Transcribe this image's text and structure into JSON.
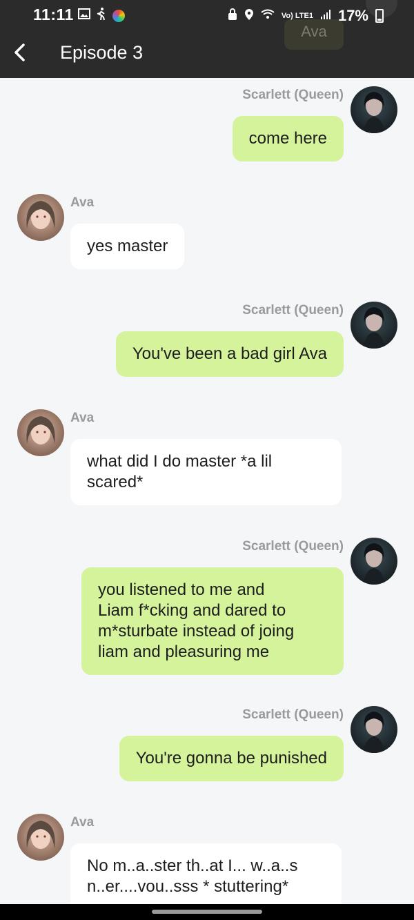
{
  "status_bar": {
    "time": "11:11",
    "battery": "17%",
    "network": "Vo) LTE1"
  },
  "header": {
    "title": "Episode 3",
    "back_icon": "chevron-left-icon",
    "ghost_chip": "Ava"
  },
  "colors": {
    "outgoing_bubble": "#d4f39b",
    "incoming_bubble": "#ffffff",
    "background": "#f5f6f8",
    "header": "#2b2b2b",
    "sender_name": "#9a9a9a"
  },
  "messages": [
    {
      "sender": "Scarlett (Queen)",
      "text": "come here",
      "direction": "out"
    },
    {
      "sender": "Ava",
      "text": "yes master",
      "direction": "in"
    },
    {
      "sender": "Scarlett (Queen)",
      "text": "You've been a bad girl Ava",
      "direction": "out"
    },
    {
      "sender": "Ava",
      "lines": [
        "what did I do master *a lil",
        "scared*"
      ],
      "direction": "in"
    },
    {
      "sender": "Scarlett (Queen)",
      "lines": [
        "you listened to me and",
        "Liam f*cking and dared to",
        "m*sturbate instead of joing",
        "liam and pleasuring me"
      ],
      "direction": "out"
    },
    {
      "sender": "Scarlett (Queen)",
      "text": "You're gonna be punished",
      "direction": "out"
    },
    {
      "sender": "Ava",
      "lines": [
        "No m..a..ster th..at I... w..a..s",
        "n..er....vou..sss * stuttering*"
      ],
      "direction": "in"
    }
  ]
}
